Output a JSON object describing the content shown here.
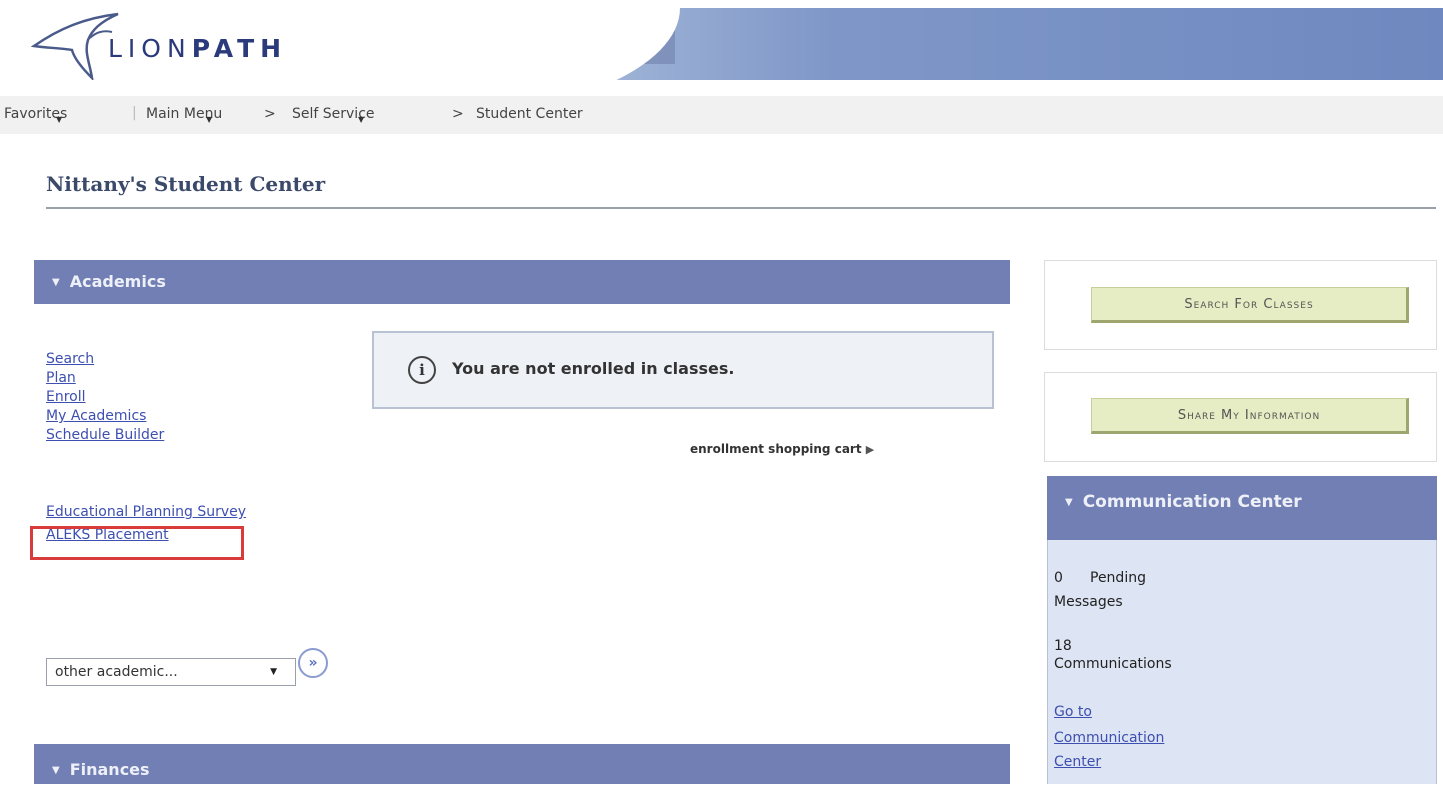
{
  "header": {
    "logo_light": "LION",
    "logo_bold": "PATH"
  },
  "nav": {
    "favorites": "Favorites",
    "main_menu": "Main Menu",
    "sep1": ">",
    "self_service": "Self Service",
    "sep2": ">",
    "student_center": "Student Center"
  },
  "page": {
    "title": "Nittany's Student Center"
  },
  "academics": {
    "header": "Academics",
    "links": [
      "Search",
      "Plan",
      "Enroll",
      "My Academics",
      "Schedule Builder"
    ],
    "links2": [
      "Educational Planning Survey",
      "ALEKS Placement"
    ],
    "notice": "You are not enrolled in classes.",
    "cart_link": "enrollment shopping cart",
    "dropdown_value": "other academic..."
  },
  "finances": {
    "header": "Finances"
  },
  "right": {
    "search_button": "Search For Classes",
    "share_button": "Share My Information",
    "comm_header": "Communication Center",
    "pending_count": "0",
    "pending_label": "Pending",
    "messages_label": "Messages",
    "comm_count": "18",
    "comm_label": "Communications",
    "goto_1": "Go to",
    "goto_2": "Communication",
    "goto_3": "Center"
  },
  "icons": {
    "info": "info-icon",
    "go": "go-double-chevron-icon",
    "collapse": "triangle-down-icon"
  },
  "colors": {
    "section_header": "#717fb4",
    "link": "#3d4fb0",
    "highlight": "#d93a3a",
    "button": "#e6ecc4"
  }
}
